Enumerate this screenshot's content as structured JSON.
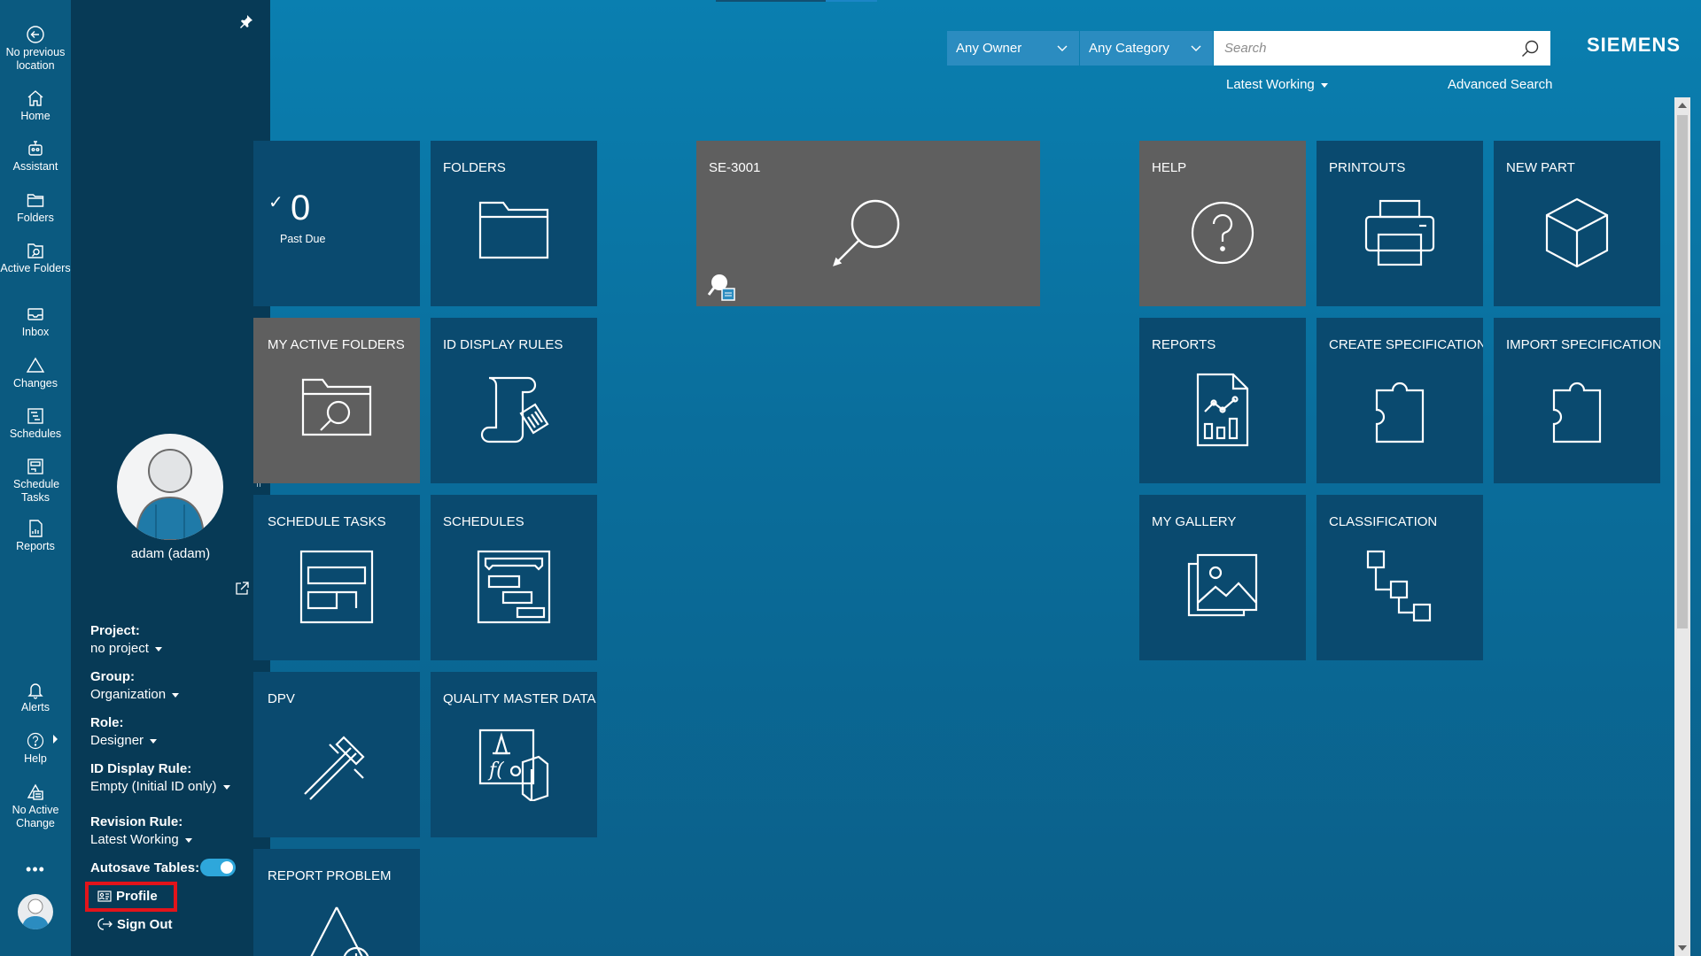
{
  "rail": {
    "items": [
      {
        "id": "no-previous-location",
        "label": "No previous location",
        "icon": "back-arrow-icon"
      },
      {
        "id": "home",
        "label": "Home",
        "icon": "home-icon"
      },
      {
        "id": "assistant",
        "label": "Assistant",
        "icon": "assistant-icon"
      },
      {
        "id": "folders",
        "label": "Folders",
        "icon": "folder-icon"
      },
      {
        "id": "active-folders",
        "label": "Active Folders",
        "icon": "active-folder-icon"
      },
      {
        "id": "inbox",
        "label": "Inbox",
        "icon": "inbox-icon"
      },
      {
        "id": "changes",
        "label": "Changes",
        "icon": "changes-icon"
      },
      {
        "id": "schedules",
        "label": "Schedules",
        "icon": "schedules-icon"
      },
      {
        "id": "schedule-tasks",
        "label": "Schedule Tasks",
        "icon": "schedule-tasks-icon"
      },
      {
        "id": "reports",
        "label": "Reports",
        "icon": "reports-icon"
      }
    ],
    "bottom_items": [
      {
        "id": "alerts",
        "label": "Alerts",
        "icon": "bell-icon"
      },
      {
        "id": "help",
        "label": "Help",
        "icon": "help-icon"
      },
      {
        "id": "no-active-change",
        "label": "No Active Change",
        "icon": "active-change-icon"
      }
    ],
    "more_label": "•••"
  },
  "profile_panel": {
    "user_name": "adam (adam)",
    "project": {
      "label": "Project:",
      "value": "no project"
    },
    "group": {
      "label": "Group:",
      "value": "Organization"
    },
    "role": {
      "label": "Role:",
      "value": "Designer"
    },
    "id_display_rule": {
      "label": "ID Display Rule:",
      "value": "Empty (Initial ID only)"
    },
    "revision_rule": {
      "label": "Revision Rule:",
      "value": "Latest Working"
    },
    "autosave": {
      "label": "Autosave Tables:",
      "on": true
    },
    "profile_label": "Profile",
    "signout_label": "Sign Out"
  },
  "header": {
    "owner_filter": "Any Owner",
    "category_filter": "Any Category",
    "search_placeholder": "Search",
    "brand": "SIEMENS",
    "revision_rule": "Latest Working",
    "advanced_search": "Advanced Search"
  },
  "tiles": {
    "my_tasks": {
      "count": "0",
      "count_label": "Past Due"
    },
    "folders": "FOLDERS",
    "se3001": "SE-3001",
    "help": "HELP",
    "printouts": "PRINTOUTS",
    "new_part": "NEW PART",
    "my_active_folders": "MY ACTIVE FOLDERS",
    "id_display_rules": "ID DISPLAY RULES",
    "reports": "REPORTS",
    "create_spec": "CREATE SPECIFICATION",
    "import_spec": "IMPORT SPECIFICATION",
    "schedule_tasks": "SCHEDULE TASKS",
    "schedules": "SCHEDULES",
    "my_gallery": "MY GALLERY",
    "classification": "CLASSIFICATION",
    "dpv": "DPV",
    "quality_master_data": "QUALITY MASTER DATA",
    "report_problem": "REPORT PROBLEM"
  },
  "colors": {
    "background": "#0a6e9c",
    "rail": "#0b5a80",
    "panel": "#073a56",
    "tile": "#0a4a6f",
    "tile_grey": "#5f5f5f",
    "highlight_border": "#e2141b",
    "toggle_on": "#2ea7db"
  }
}
